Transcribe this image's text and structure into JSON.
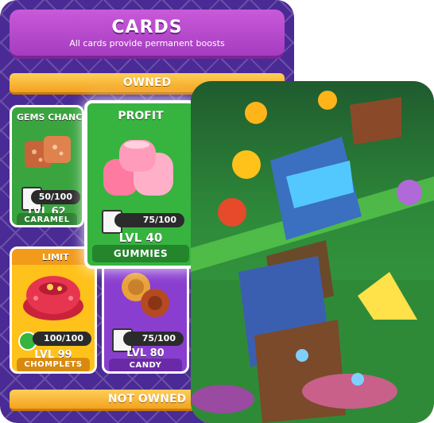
{
  "header": {
    "title": "CARDS",
    "subtitle": "All cards provide permanent boosts"
  },
  "sections": {
    "owned": "OWNED",
    "not_owned": "NOT OWNED"
  },
  "cards": [
    {
      "label": "GEMS CHANCE",
      "progress_text": "50/100",
      "progress": 0.5,
      "level": "LVL 62",
      "name": "CARAMEL",
      "color": "#3aa53f"
    },
    {
      "label": "PROFIT",
      "progress_text": "75/100",
      "progress": 0.75,
      "level": "LVL 40",
      "name": "GUMMIES",
      "color": "#36b43f"
    },
    {
      "label": "LIMIT",
      "progress_text": "100/100",
      "progress": 1.0,
      "level": "LVL 99",
      "name": "CHOMPLETS",
      "color": "#ffc21a"
    },
    {
      "label": "",
      "progress_text": "75/100",
      "progress": 0.75,
      "level": "LVL 80",
      "name": "CANDY",
      "color": "#8a3ed0"
    }
  ]
}
